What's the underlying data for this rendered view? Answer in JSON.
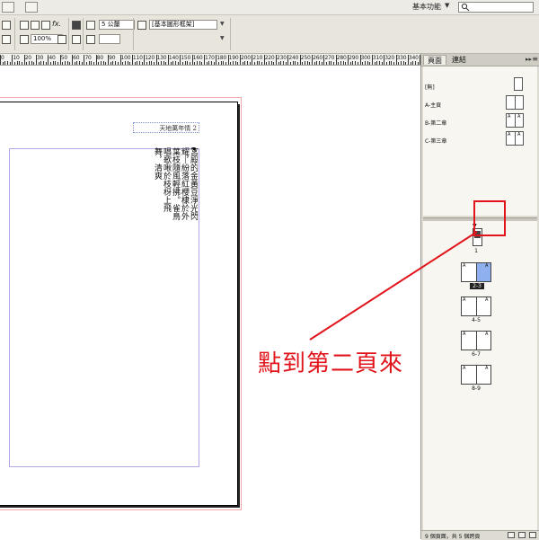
{
  "menubar": {
    "workspace_label": "基本功能",
    "workspace_caret": "▼",
    "search_icon": "search-icon"
  },
  "controlbar": {
    "stroke_weight_value": "5 公釐",
    "object_style_value": "[基本圖形框架]",
    "zoom_value": "100%"
  },
  "ruler": {
    "labels": [
      "0",
      "10",
      "20",
      "30",
      "40",
      "50",
      "60",
      "70",
      "80",
      "90",
      "100",
      "110",
      "120",
      "130",
      "140",
      "150",
      "160",
      "170",
      "180",
      "190",
      "200",
      "210",
      "220",
      "230",
      "240",
      "250",
      "260",
      "270",
      "280",
      "290",
      "300",
      "310",
      "320",
      "330",
      "340",
      "350",
      "360",
      "370",
      "380"
    ]
  },
  "document": {
    "running_header": "天地萬年情 2",
    "vertical_text": "宮殿的金黃豆淨光閃耀，紛落紅櫻棣於外葉枝隨風輕拂。雀鳥唱歌啾於枝枒上飛舞，清爽"
  },
  "pages_panel": {
    "tabs": {
      "pages": "頁面",
      "links": "連結"
    },
    "menu_glyph": "▸▸",
    "options_glyph": "≡",
    "masters": [
      {
        "label": "[無]"
      },
      {
        "label": "A-主頁"
      },
      {
        "label": "B-第二章"
      },
      {
        "label": "C-第三章"
      }
    ],
    "master_thumb_letter": "A",
    "pages": [
      {
        "label": "1"
      },
      {
        "label": "2-3"
      },
      {
        "label": "4-5"
      },
      {
        "label": "6-7"
      },
      {
        "label": "8-9"
      }
    ],
    "footer": {
      "page_count": "9 個頁面，共 5 個跨頁"
    }
  },
  "annotation": {
    "text": "點到第二頁來",
    "color": "#e0141a"
  },
  "colors": {
    "selection": "#8fb0ef",
    "annotation_red": "#e0141a",
    "bleed_guide": "#f2a6a6",
    "margin_guide": "#b7a6e6"
  }
}
